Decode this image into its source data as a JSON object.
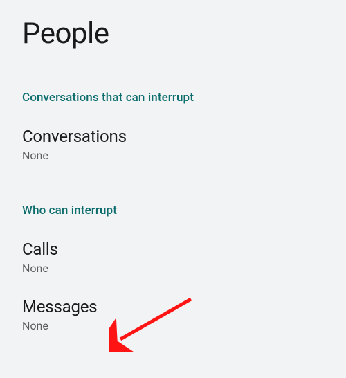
{
  "page": {
    "title": "People"
  },
  "sections": {
    "conversations_interrupt": {
      "header": "Conversations that can interrupt",
      "items": {
        "conversations": {
          "title": "Conversations",
          "value": "None"
        }
      }
    },
    "who_interrupt": {
      "header": "Who can interrupt",
      "items": {
        "calls": {
          "title": "Calls",
          "value": "None"
        },
        "messages": {
          "title": "Messages",
          "value": "None"
        }
      }
    }
  }
}
